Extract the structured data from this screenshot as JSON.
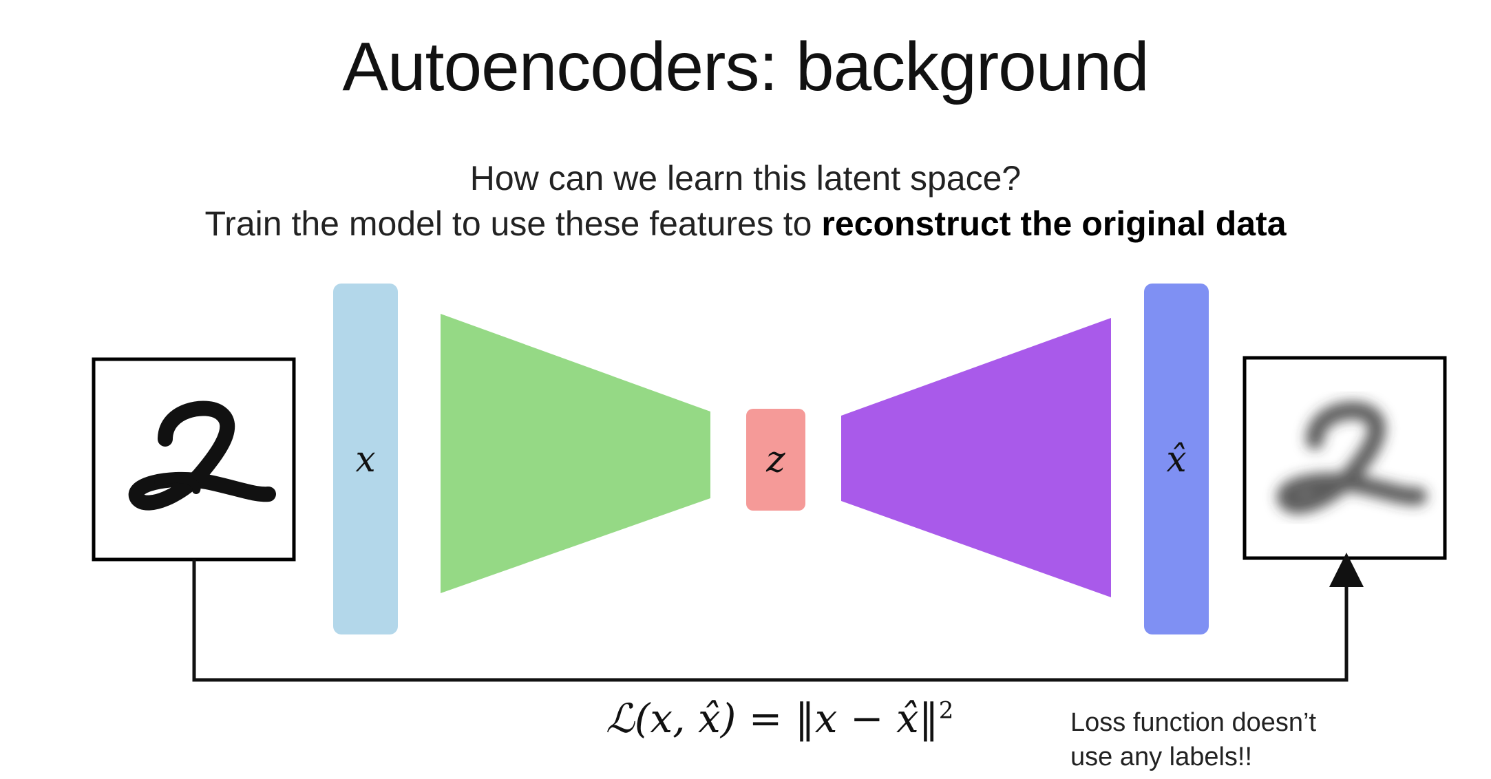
{
  "title": "Autoencoders: background",
  "subtitle_line1": "How can we learn this latent space?",
  "subtitle_line2_plain": "Train the model to use these features to ",
  "subtitle_line2_bold": "reconstruct the original data",
  "labels": {
    "input_vector": "x",
    "latent": "z",
    "output_vector": "x̂"
  },
  "formula": {
    "lhs": "ℒ(x, x̂) = ‖x − x̂‖",
    "exponent": "2"
  },
  "note": "Loss function doesn’t use any labels!!",
  "colors": {
    "input_bar": "#b3d7ea",
    "encoder": "#95d985",
    "latent": "#f59a98",
    "decoder": "#a95aea",
    "output_bar": "#7f90f3",
    "arrow": "#111111"
  },
  "icons": {
    "input_image": "handwritten-digit-2-icon",
    "output_image": "blurred-digit-2-icon"
  }
}
